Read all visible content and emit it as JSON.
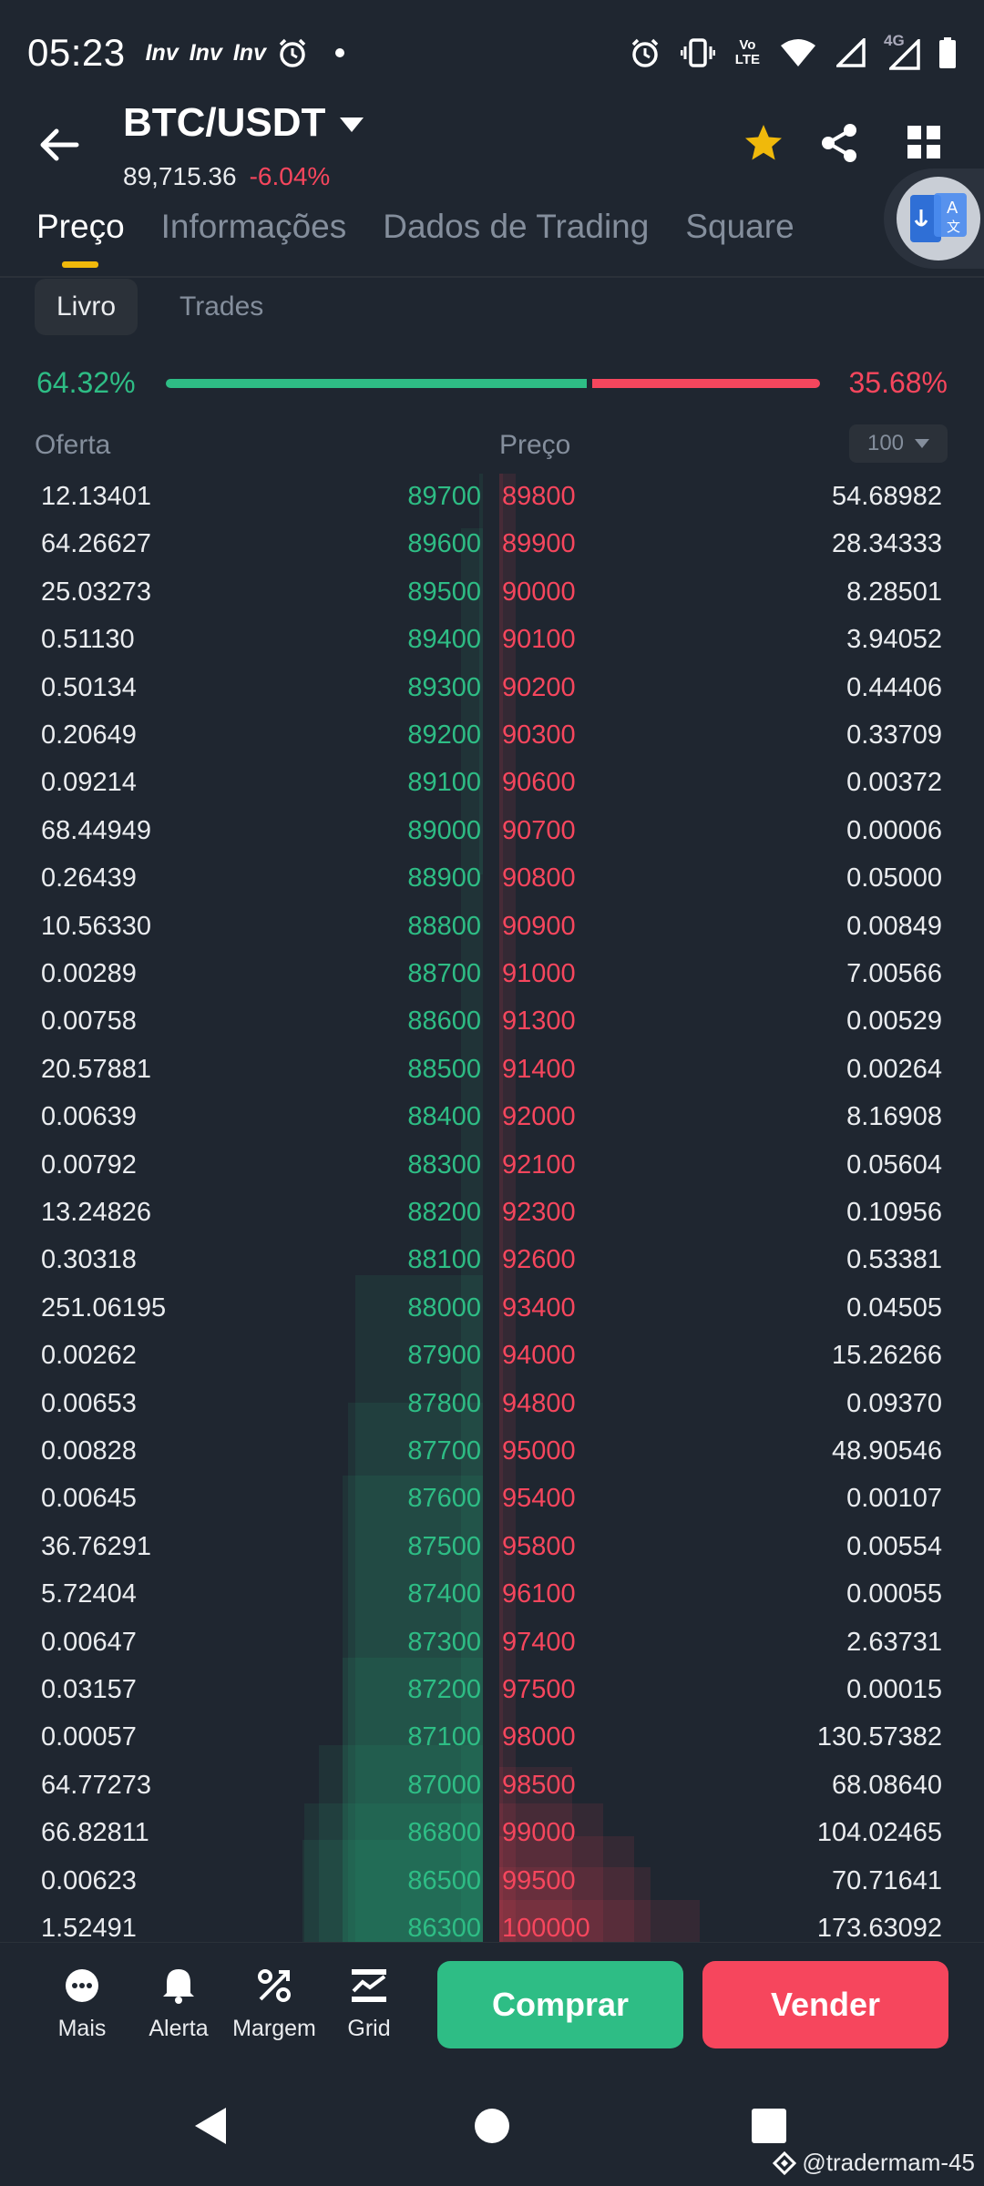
{
  "status_bar": {
    "time": "05:23",
    "notif_apps": [
      "Inv",
      "Inv",
      "Inv"
    ],
    "icons": [
      "alarm-icon",
      "vibrate-icon",
      "volte-icon",
      "wifi-icon",
      "signal-icon",
      "signal-4g-icon",
      "battery-icon"
    ],
    "volte_line1": "Vo",
    "volte_line2": "LTE",
    "network_label": "4G"
  },
  "header": {
    "pair": "BTC/USDT",
    "last_price": "89,715.36",
    "change": "-6.04%"
  },
  "tabs": [
    {
      "label": "Preço",
      "active": true
    },
    {
      "label": "Informações",
      "active": false
    },
    {
      "label": "Dados de Trading",
      "active": false
    },
    {
      "label": "Square",
      "active": false
    }
  ],
  "subtabs": [
    {
      "label": "Livro",
      "active": true
    },
    {
      "label": "Trades",
      "active": false
    }
  ],
  "ratio": {
    "bid": "64.32%",
    "ask": "35.68%",
    "bid_fraction": 0.6432
  },
  "columns": {
    "bid": "Oferta",
    "price": "Preço",
    "aggregation": "100"
  },
  "order_book": [
    {
      "bid_qty": "12.13401",
      "bid_price": "89700",
      "ask_price": "89800",
      "ask_qty": "54.68982"
    },
    {
      "bid_qty": "64.26627",
      "bid_price": "89600",
      "ask_price": "89900",
      "ask_qty": "28.34333"
    },
    {
      "bid_qty": "25.03273",
      "bid_price": "89500",
      "ask_price": "90000",
      "ask_qty": "8.28501"
    },
    {
      "bid_qty": "0.51130",
      "bid_price": "89400",
      "ask_price": "90100",
      "ask_qty": "3.94052"
    },
    {
      "bid_qty": "0.50134",
      "bid_price": "89300",
      "ask_price": "90200",
      "ask_qty": "0.44406"
    },
    {
      "bid_qty": "0.20649",
      "bid_price": "89200",
      "ask_price": "90300",
      "ask_qty": "0.33709"
    },
    {
      "bid_qty": "0.09214",
      "bid_price": "89100",
      "ask_price": "90600",
      "ask_qty": "0.00372"
    },
    {
      "bid_qty": "68.44949",
      "bid_price": "89000",
      "ask_price": "90700",
      "ask_qty": "0.00006"
    },
    {
      "bid_qty": "0.26439",
      "bid_price": "88900",
      "ask_price": "90800",
      "ask_qty": "0.05000"
    },
    {
      "bid_qty": "10.56330",
      "bid_price": "88800",
      "ask_price": "90900",
      "ask_qty": "0.00849"
    },
    {
      "bid_qty": "0.00289",
      "bid_price": "88700",
      "ask_price": "91000",
      "ask_qty": "7.00566"
    },
    {
      "bid_qty": "0.00758",
      "bid_price": "88600",
      "ask_price": "91300",
      "ask_qty": "0.00529"
    },
    {
      "bid_qty": "20.57881",
      "bid_price": "88500",
      "ask_price": "91400",
      "ask_qty": "0.00264"
    },
    {
      "bid_qty": "0.00639",
      "bid_price": "88400",
      "ask_price": "92000",
      "ask_qty": "8.16908"
    },
    {
      "bid_qty": "0.00792",
      "bid_price": "88300",
      "ask_price": "92100",
      "ask_qty": "0.05604"
    },
    {
      "bid_qty": "13.24826",
      "bid_price": "88200",
      "ask_price": "92300",
      "ask_qty": "0.10956"
    },
    {
      "bid_qty": "0.30318",
      "bid_price": "88100",
      "ask_price": "92600",
      "ask_qty": "0.53381"
    },
    {
      "bid_qty": "251.06195",
      "bid_price": "88000",
      "ask_price": "93400",
      "ask_qty": "0.04505"
    },
    {
      "bid_qty": "0.00262",
      "bid_price": "87900",
      "ask_price": "94000",
      "ask_qty": "15.26266"
    },
    {
      "bid_qty": "0.00653",
      "bid_price": "87800",
      "ask_price": "94800",
      "ask_qty": "0.09370"
    },
    {
      "bid_qty": "0.00828",
      "bid_price": "87700",
      "ask_price": "95000",
      "ask_qty": "48.90546"
    },
    {
      "bid_qty": "0.00645",
      "bid_price": "87600",
      "ask_price": "95400",
      "ask_qty": "0.00107"
    },
    {
      "bid_qty": "36.76291",
      "bid_price": "87500",
      "ask_price": "95800",
      "ask_qty": "0.00554"
    },
    {
      "bid_qty": "5.72404",
      "bid_price": "87400",
      "ask_price": "96100",
      "ask_qty": "0.00055"
    },
    {
      "bid_qty": "0.00647",
      "bid_price": "87300",
      "ask_price": "97400",
      "ask_qty": "2.63731"
    },
    {
      "bid_qty": "0.03157",
      "bid_price": "87200",
      "ask_price": "97500",
      "ask_qty": "0.00015"
    },
    {
      "bid_qty": "0.00057",
      "bid_price": "87100",
      "ask_price": "98000",
      "ask_qty": "130.57382"
    },
    {
      "bid_qty": "64.77273",
      "bid_price": "87000",
      "ask_price": "98500",
      "ask_qty": "68.08640"
    },
    {
      "bid_qty": "66.82811",
      "bid_price": "86800",
      "ask_price": "99000",
      "ask_qty": "104.02465"
    },
    {
      "bid_qty": "0.00623",
      "bid_price": "86500",
      "ask_price": "99500",
      "ask_qty": "70.71641"
    },
    {
      "bid_qty": "1.52491",
      "bid_price": "86300",
      "ask_price": "100000",
      "ask_qty": "173.63092"
    }
  ],
  "bottom_actions": [
    {
      "label": "Mais",
      "icon": "more-icon"
    },
    {
      "label": "Alerta",
      "icon": "bell-icon"
    },
    {
      "label": "Margem",
      "icon": "margin-icon"
    },
    {
      "label": "Grid",
      "icon": "grid-chart-icon"
    }
  ],
  "buy_label": "Comprar",
  "sell_label": "Vender",
  "watermark": "@tradermam-45",
  "colors": {
    "bg": "#1f2630",
    "green": "#2ebd85",
    "red": "#f6465d",
    "accent": "#f0b90b",
    "muted": "#848e9c"
  }
}
